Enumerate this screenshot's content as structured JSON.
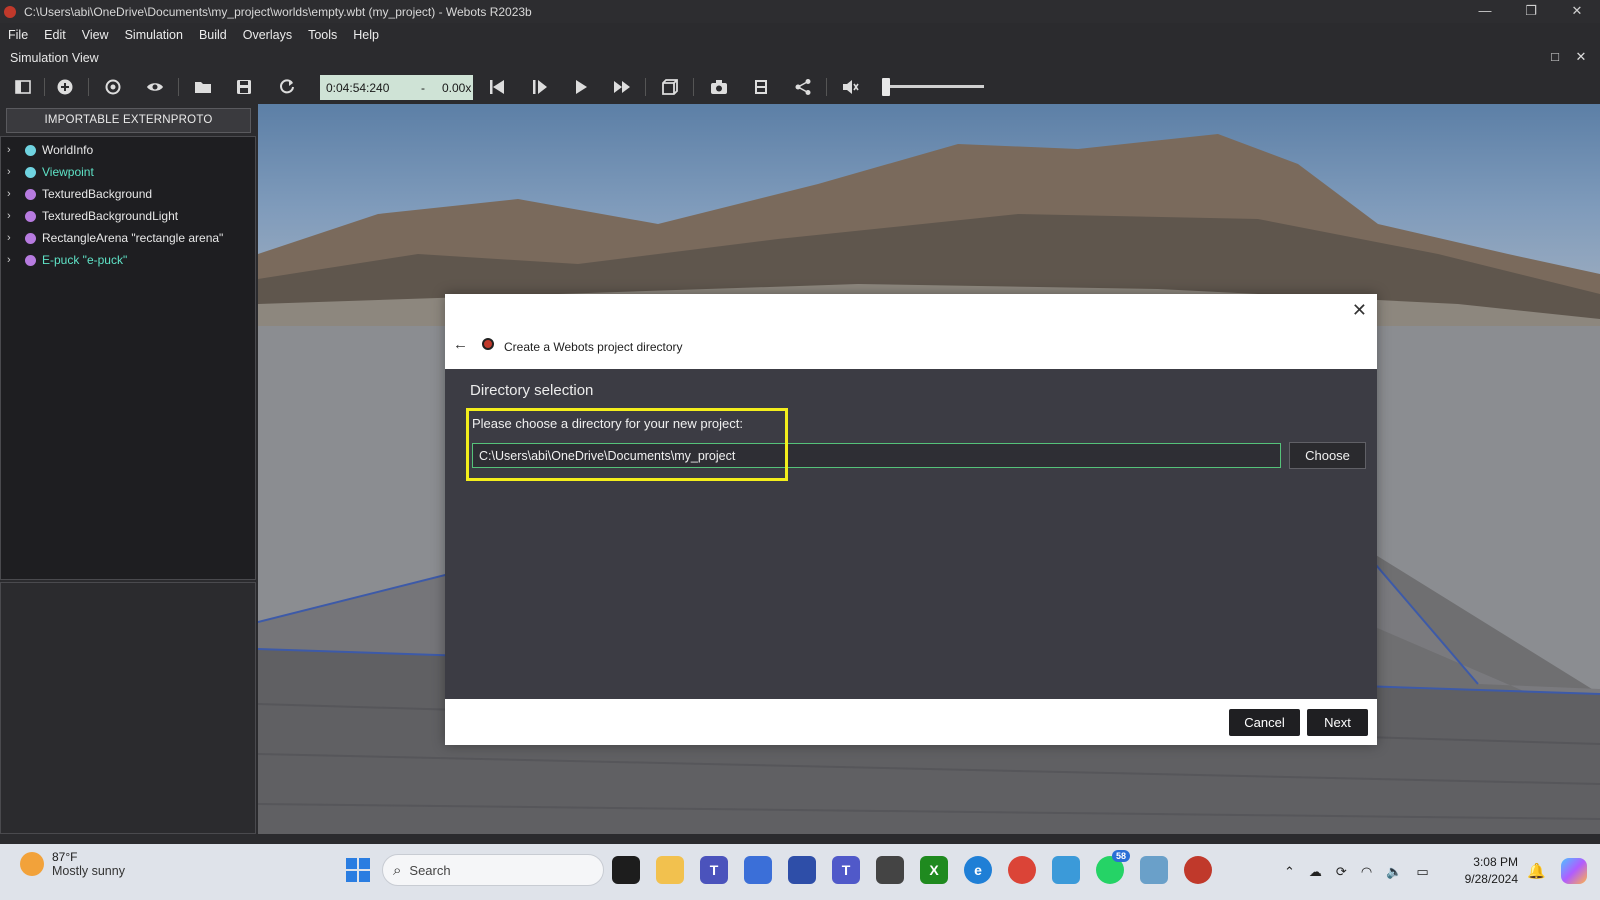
{
  "titlebar": {
    "title": "C:\\Users\\abi\\OneDrive\\Documents\\my_project\\worlds\\empty.wbt (my_project) - Webots R2023b",
    "minimize": "—",
    "restore": "❐",
    "close": "✕"
  },
  "menu": [
    "File",
    "Edit",
    "View",
    "Simulation",
    "Build",
    "Overlays",
    "Tools",
    "Help"
  ],
  "sim_header": {
    "label": "Simulation View",
    "maximize": "□",
    "close": "✕"
  },
  "toolbar": {
    "time": "0:04:54:240",
    "dash": "-",
    "speed": "0.00x"
  },
  "left_panel": {
    "proto_button": "IMPORTABLE EXTERNPROTO",
    "tree": [
      {
        "label": "WorldInfo",
        "dot": "#6fd3e0",
        "text_color": "#e8e8e8"
      },
      {
        "label": "Viewpoint",
        "dot": "#6fd3e0",
        "text_color": "#5fe3c7"
      },
      {
        "label": "TexturedBackground",
        "dot": "#b77be0",
        "text_color": "#e8e8e8"
      },
      {
        "label": "TexturedBackgroundLight",
        "dot": "#b77be0",
        "text_color": "#e8e8e8"
      },
      {
        "label": "RectangleArena \"rectangle arena\"",
        "dot": "#b77be0",
        "text_color": "#e8e8e8"
      },
      {
        "label": "E-puck \"e-puck\"",
        "dot": "#b77be0",
        "text_color": "#5fe3c7"
      }
    ]
  },
  "dialog": {
    "title": "Create a Webots project directory",
    "section": "Directory selection",
    "prompt": "Please choose a directory for your new project:",
    "path_value": "C:\\Users\\abi\\OneDrive\\Documents\\my_project",
    "choose_label": "Choose",
    "cancel_label": "Cancel",
    "next_label": "Next",
    "highlight_color": "#f3ee1c"
  },
  "taskbar": {
    "weather_temp": "87°F",
    "weather_desc": "Mostly sunny",
    "search_placeholder": "Search",
    "whatsapp_badge": "58",
    "time": "3:08 PM",
    "date": "9/28/2024"
  }
}
